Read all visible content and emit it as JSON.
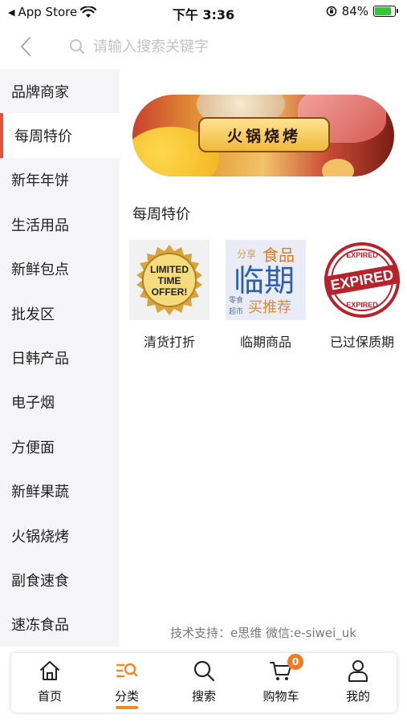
{
  "status_bar": {
    "back_app": "App Store",
    "time": "下午 3:36",
    "battery": "84%",
    "battery_level": 0.84
  },
  "search": {
    "placeholder": "请输入搜索关键字"
  },
  "sidebar": {
    "active_index": 1,
    "items": [
      {
        "label": "品牌商家"
      },
      {
        "label": "每周特价"
      },
      {
        "label": "新年年饼"
      },
      {
        "label": "生活用品"
      },
      {
        "label": "新鲜包点"
      },
      {
        "label": "批发区"
      },
      {
        "label": "日韩产品"
      },
      {
        "label": "电子烟"
      },
      {
        "label": "方便面"
      },
      {
        "label": "新鲜果蔬"
      },
      {
        "label": "火锅烧烤"
      },
      {
        "label": "副食速食"
      },
      {
        "label": "速冻食品"
      }
    ]
  },
  "banner": {
    "label": "火锅烧烤"
  },
  "section": {
    "title": "每周特价"
  },
  "products": [
    {
      "name": "清货打折",
      "image_text": [
        "LIMITED",
        "TIME",
        "OFFER!"
      ]
    },
    {
      "name": "临期商品",
      "image_text": [
        "分享",
        "食品",
        "临期",
        "零食",
        "超市",
        "买推荐"
      ]
    },
    {
      "name": "已过保质期",
      "image_text": [
        "EXPIRED",
        "EXPIRED",
        "EXPIRED"
      ]
    }
  ],
  "footer": {
    "tech_support": "技术支持：e思维 微信:e-siwei_uk"
  },
  "tabbar": {
    "active_index": 1,
    "items": [
      {
        "label": "首页",
        "icon": "home-icon"
      },
      {
        "label": "分类",
        "icon": "category-icon"
      },
      {
        "label": "搜索",
        "icon": "search-icon"
      },
      {
        "label": "购物车",
        "icon": "cart-icon",
        "badge": "0"
      },
      {
        "label": "我的",
        "icon": "profile-icon"
      }
    ]
  },
  "colors": {
    "accent": "#e8503a",
    "tab_underline": "#f28a1e",
    "badge": "#f07b25",
    "sidebar_bg": "#f5f5f7"
  }
}
